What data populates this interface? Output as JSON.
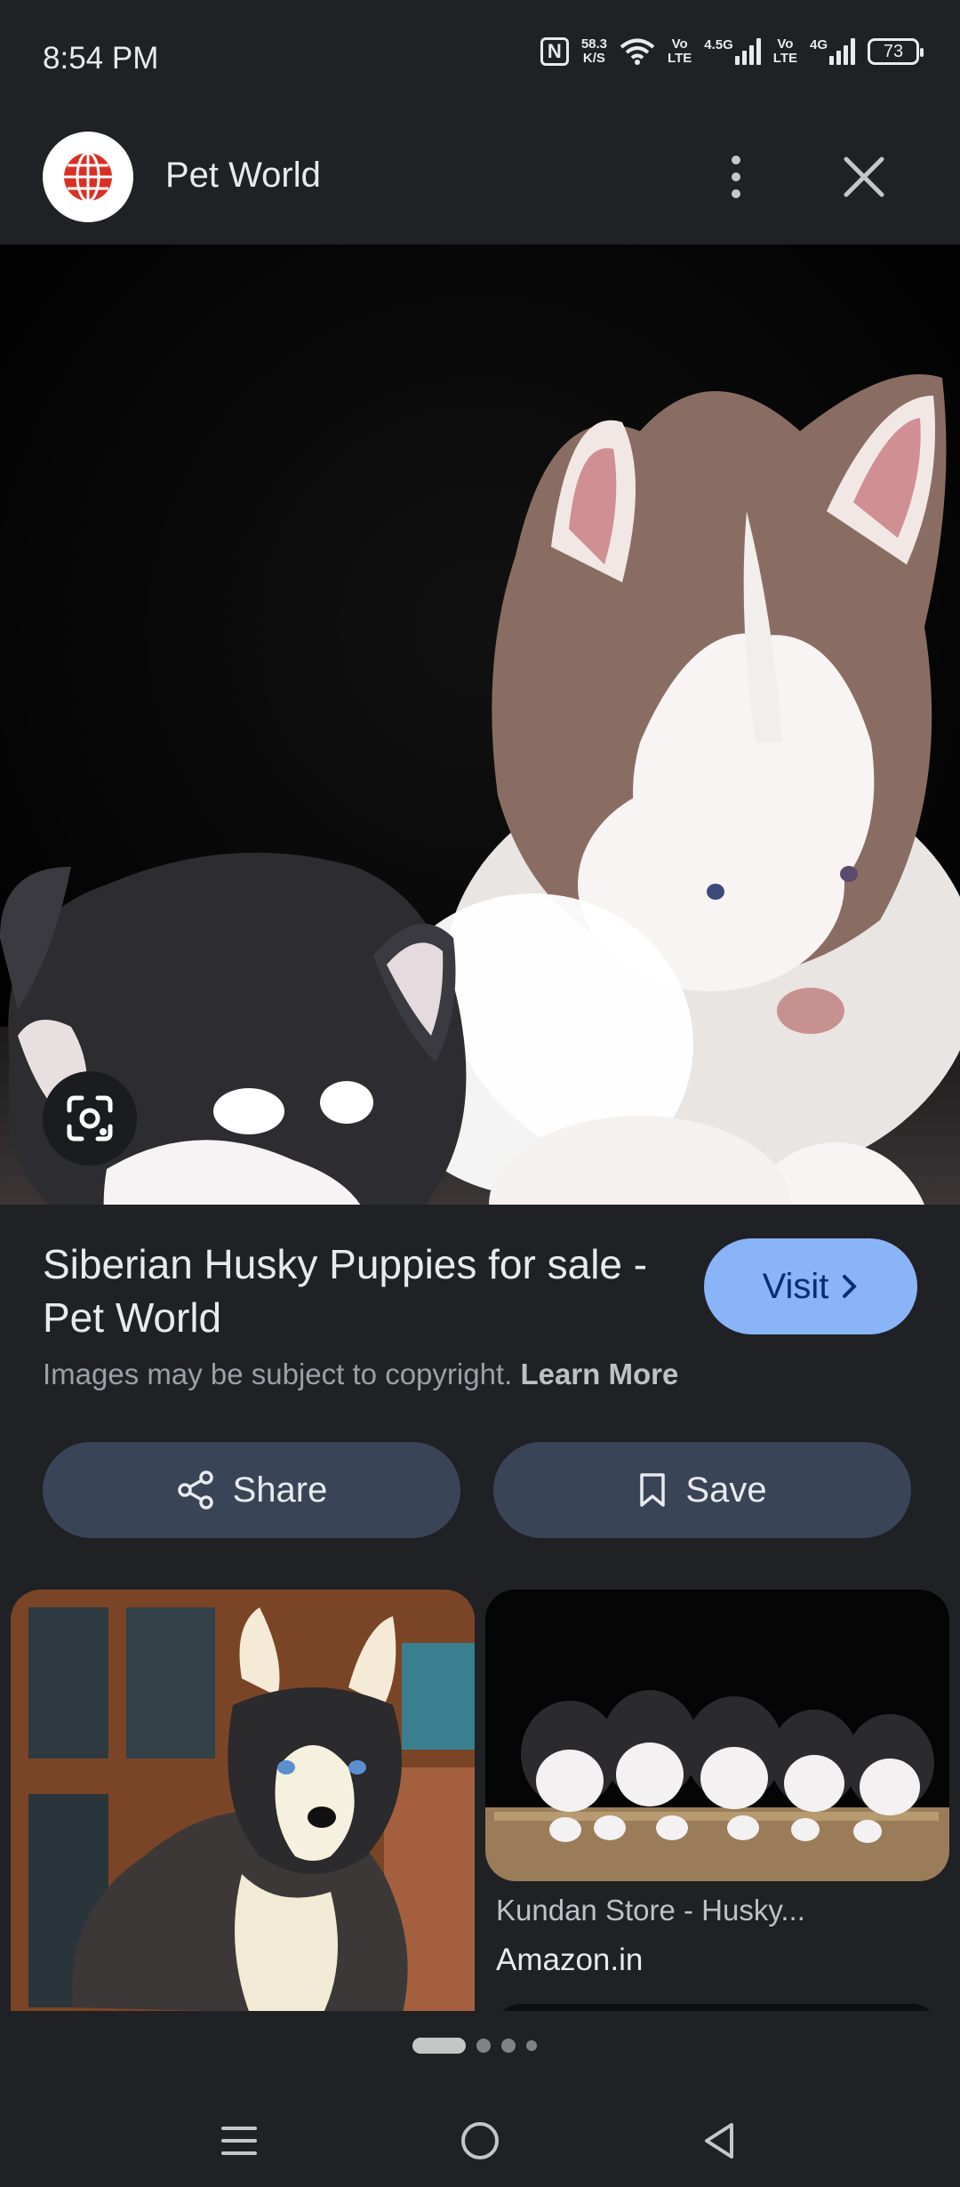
{
  "status_bar": {
    "time": "8:54 PM",
    "net_speed_value": "58.3",
    "net_speed_unit": "K/S",
    "volte1_top": "Vo",
    "volte1_bottom": "LTE",
    "net_type1": "4.5G",
    "volte2_top": "Vo",
    "volte2_bottom": "LTE",
    "net_type2": "4G",
    "battery": "73"
  },
  "header": {
    "site_name": "Pet World"
  },
  "result": {
    "title": "Siberian Husky Puppies for sale - Pet World",
    "visit_label": "Visit",
    "copyright_text": "Images may be subject to copyright.",
    "learn_more": "Learn More"
  },
  "actions": {
    "share_label": "Share",
    "save_label": "Save"
  },
  "related": [
    {
      "title": "",
      "source": ""
    },
    {
      "title": "Kundan Store - Husky...",
      "source": "Amazon.in"
    }
  ],
  "colors": {
    "background": "#202125",
    "visit_button": "#8ab4f8",
    "action_button": "#394457"
  },
  "icons": [
    "nfc-icon",
    "wifi-icon",
    "signal-icon",
    "battery-icon",
    "globe-logo-icon",
    "more-vert-icon",
    "close-icon",
    "lens-icon",
    "chevron-right-icon",
    "share-icon",
    "bookmark-icon",
    "menu-icon",
    "home-icon",
    "back-icon"
  ]
}
